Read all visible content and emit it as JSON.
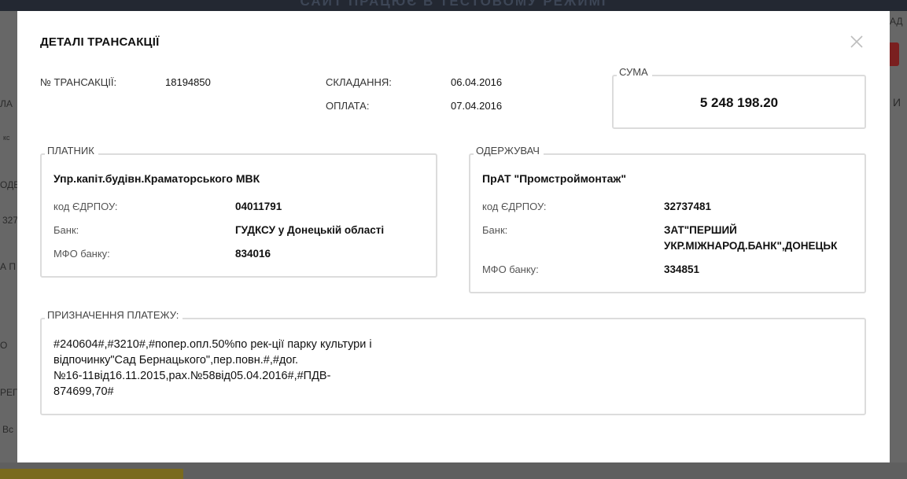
{
  "background": {
    "banner": "САЙТ ПРАЦЮЄ В ТЕСТОВОМУ РЕЖИМІ",
    "left_fragments": [
      "ЛА",
      "кс",
      "ОДЕ",
      "327",
      "А П",
      "О",
      "РЕГ",
      "Вс"
    ],
    "right_fragments": [
      "АД",
      "И"
    ]
  },
  "modal": {
    "title": "ДЕТАЛІ ТРАНСАКЦІЇ",
    "close_icon": "close-icon",
    "transaction": {
      "id_label": "№ ТРАНСАКЦІЇ:",
      "id_value": "18194850",
      "created_label": "СКЛАДАННЯ:",
      "created_value": "06.04.2016",
      "paid_label": "ОПЛАТА:",
      "paid_value": "07.04.2016"
    },
    "sum": {
      "legend": "СУМА",
      "value": "5 248 198.20"
    },
    "payer": {
      "legend": "ПЛАТНИК",
      "name": "Упр.капіт.будівн.Краматорського МВК",
      "edrpou_label": "код ЄДРПОУ:",
      "edrpou_value": "04011791",
      "bank_label": "Банк:",
      "bank_value": "ГУДКСУ у Донецькій області",
      "mfo_label": "МФО банку:",
      "mfo_value": "834016"
    },
    "recipient": {
      "legend": "ОДЕРЖУВАЧ",
      "name": "ПрАТ \"Промстроймонтаж\"",
      "edrpou_label": "код ЄДРПОУ:",
      "edrpou_value": "32737481",
      "bank_label": "Банк:",
      "bank_value_line1": "ЗАТ\"ПЕРШИЙ",
      "bank_value_line2": "УКР.МІЖНАРОД.БАНК\",ДОНЕЦЬК",
      "mfo_label": "МФО банку:",
      "mfo_value": "334851"
    },
    "purpose": {
      "legend": "ПРИЗНАЧЕННЯ ПЛАТЕЖУ:",
      "line1": "#240604#,#3210#,#попер.опл.50%по рек-ції парку культури і",
      "line2": "відпочинку\"Сад Бернацького\",пер.повн.#,#дог.",
      "line3": "№16-11від16.11.2015,рах.№58від05.04.2016#,#ПДВ-",
      "line4": "874699,70#"
    }
  }
}
